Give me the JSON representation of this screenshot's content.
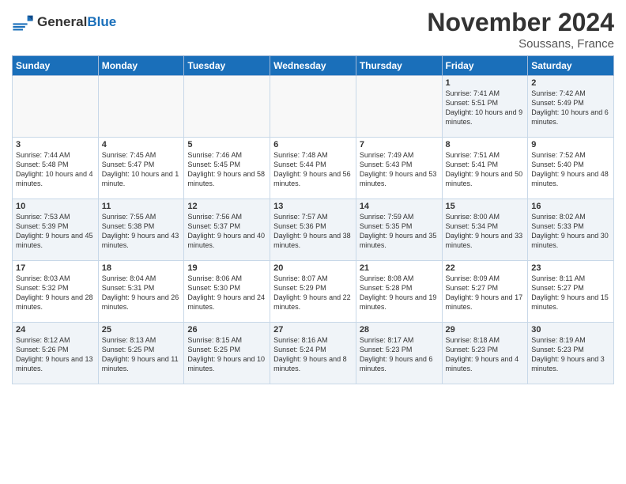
{
  "header": {
    "logo_line1": "General",
    "logo_line2": "Blue",
    "month_title": "November 2024",
    "location": "Soussans, France"
  },
  "days_of_week": [
    "Sunday",
    "Monday",
    "Tuesday",
    "Wednesday",
    "Thursday",
    "Friday",
    "Saturday"
  ],
  "weeks": [
    [
      {
        "day": "",
        "info": ""
      },
      {
        "day": "",
        "info": ""
      },
      {
        "day": "",
        "info": ""
      },
      {
        "day": "",
        "info": ""
      },
      {
        "day": "",
        "info": ""
      },
      {
        "day": "1",
        "info": "Sunrise: 7:41 AM\nSunset: 5:51 PM\nDaylight: 10 hours and 9 minutes."
      },
      {
        "day": "2",
        "info": "Sunrise: 7:42 AM\nSunset: 5:49 PM\nDaylight: 10 hours and 6 minutes."
      }
    ],
    [
      {
        "day": "3",
        "info": "Sunrise: 7:44 AM\nSunset: 5:48 PM\nDaylight: 10 hours and 4 minutes."
      },
      {
        "day": "4",
        "info": "Sunrise: 7:45 AM\nSunset: 5:47 PM\nDaylight: 10 hours and 1 minute."
      },
      {
        "day": "5",
        "info": "Sunrise: 7:46 AM\nSunset: 5:45 PM\nDaylight: 9 hours and 58 minutes."
      },
      {
        "day": "6",
        "info": "Sunrise: 7:48 AM\nSunset: 5:44 PM\nDaylight: 9 hours and 56 minutes."
      },
      {
        "day": "7",
        "info": "Sunrise: 7:49 AM\nSunset: 5:43 PM\nDaylight: 9 hours and 53 minutes."
      },
      {
        "day": "8",
        "info": "Sunrise: 7:51 AM\nSunset: 5:41 PM\nDaylight: 9 hours and 50 minutes."
      },
      {
        "day": "9",
        "info": "Sunrise: 7:52 AM\nSunset: 5:40 PM\nDaylight: 9 hours and 48 minutes."
      }
    ],
    [
      {
        "day": "10",
        "info": "Sunrise: 7:53 AM\nSunset: 5:39 PM\nDaylight: 9 hours and 45 minutes."
      },
      {
        "day": "11",
        "info": "Sunrise: 7:55 AM\nSunset: 5:38 PM\nDaylight: 9 hours and 43 minutes."
      },
      {
        "day": "12",
        "info": "Sunrise: 7:56 AM\nSunset: 5:37 PM\nDaylight: 9 hours and 40 minutes."
      },
      {
        "day": "13",
        "info": "Sunrise: 7:57 AM\nSunset: 5:36 PM\nDaylight: 9 hours and 38 minutes."
      },
      {
        "day": "14",
        "info": "Sunrise: 7:59 AM\nSunset: 5:35 PM\nDaylight: 9 hours and 35 minutes."
      },
      {
        "day": "15",
        "info": "Sunrise: 8:00 AM\nSunset: 5:34 PM\nDaylight: 9 hours and 33 minutes."
      },
      {
        "day": "16",
        "info": "Sunrise: 8:02 AM\nSunset: 5:33 PM\nDaylight: 9 hours and 30 minutes."
      }
    ],
    [
      {
        "day": "17",
        "info": "Sunrise: 8:03 AM\nSunset: 5:32 PM\nDaylight: 9 hours and 28 minutes."
      },
      {
        "day": "18",
        "info": "Sunrise: 8:04 AM\nSunset: 5:31 PM\nDaylight: 9 hours and 26 minutes."
      },
      {
        "day": "19",
        "info": "Sunrise: 8:06 AM\nSunset: 5:30 PM\nDaylight: 9 hours and 24 minutes."
      },
      {
        "day": "20",
        "info": "Sunrise: 8:07 AM\nSunset: 5:29 PM\nDaylight: 9 hours and 22 minutes."
      },
      {
        "day": "21",
        "info": "Sunrise: 8:08 AM\nSunset: 5:28 PM\nDaylight: 9 hours and 19 minutes."
      },
      {
        "day": "22",
        "info": "Sunrise: 8:09 AM\nSunset: 5:27 PM\nDaylight: 9 hours and 17 minutes."
      },
      {
        "day": "23",
        "info": "Sunrise: 8:11 AM\nSunset: 5:27 PM\nDaylight: 9 hours and 15 minutes."
      }
    ],
    [
      {
        "day": "24",
        "info": "Sunrise: 8:12 AM\nSunset: 5:26 PM\nDaylight: 9 hours and 13 minutes."
      },
      {
        "day": "25",
        "info": "Sunrise: 8:13 AM\nSunset: 5:25 PM\nDaylight: 9 hours and 11 minutes."
      },
      {
        "day": "26",
        "info": "Sunrise: 8:15 AM\nSunset: 5:25 PM\nDaylight: 9 hours and 10 minutes."
      },
      {
        "day": "27",
        "info": "Sunrise: 8:16 AM\nSunset: 5:24 PM\nDaylight: 9 hours and 8 minutes."
      },
      {
        "day": "28",
        "info": "Sunrise: 8:17 AM\nSunset: 5:23 PM\nDaylight: 9 hours and 6 minutes."
      },
      {
        "day": "29",
        "info": "Sunrise: 8:18 AM\nSunset: 5:23 PM\nDaylight: 9 hours and 4 minutes."
      },
      {
        "day": "30",
        "info": "Sunrise: 8:19 AM\nSunset: 5:23 PM\nDaylight: 9 hours and 3 minutes."
      }
    ]
  ]
}
